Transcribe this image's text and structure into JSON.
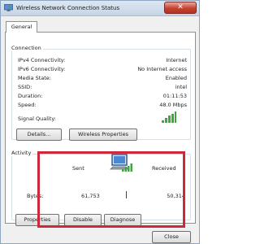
{
  "window": {
    "title": "Wireless Network Connection Status",
    "close_symbol": "✕",
    "icons": [
      "network-icon",
      "close-icon",
      "signal-bars-icon",
      "computer-network-icon"
    ],
    "accent_color": "#cc2a3a"
  },
  "tabs": [
    {
      "label": "General",
      "selected": true
    }
  ],
  "connection": {
    "label": "Connection",
    "rows": [
      {
        "label": "IPv4 Connectivity:",
        "value": "Internet"
      },
      {
        "label": "IPv6 Connectivity:",
        "value": "No Internet access"
      },
      {
        "label": "Media State:",
        "value": "Enabled"
      },
      {
        "label": "SSID:",
        "value": "intel"
      },
      {
        "label": "Duration:",
        "value": "01:11:53"
      },
      {
        "label": "Speed:",
        "value": "48.0 Mbps"
      }
    ],
    "signal_quality_label": "Signal Quality:",
    "signal_bars_lit": 5,
    "details_button": "Details...",
    "wireless_properties_button": "Wireless Properties"
  },
  "activity": {
    "label": "Activity",
    "sent_label": "Sent",
    "received_label": "Received",
    "bytes_label": "Bytes:",
    "bytes_sent": "61,753",
    "bytes_received": "50,314",
    "properties_button": "Properties",
    "disable_button": "Disable",
    "diagnose_button": "Diagnose"
  },
  "footer": {
    "close_button": "Close"
  }
}
